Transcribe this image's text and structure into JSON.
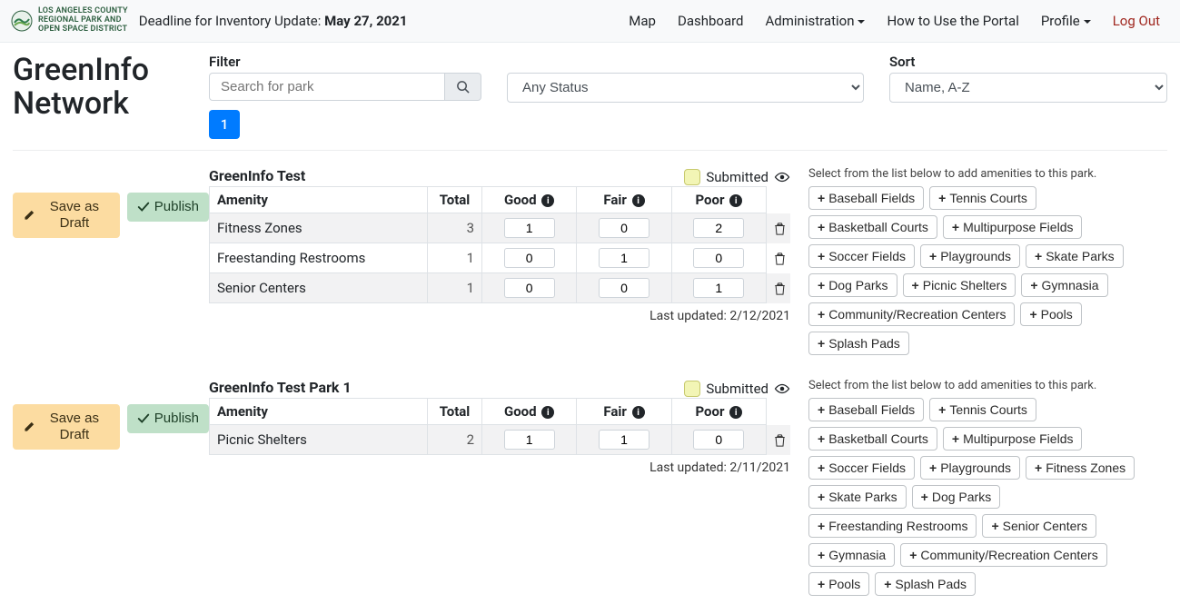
{
  "brand": {
    "line1": "LOS ANGELES COUNTY",
    "line2": "REGIONAL PARK AND",
    "line3": "OPEN SPACE DISTRICT"
  },
  "deadline": {
    "prefix": "Deadline for Inventory Update: ",
    "date": "May 27, 2021"
  },
  "nav": {
    "map": "Map",
    "dashboard": "Dashboard",
    "admin": "Administration",
    "howto": "How to Use the Portal",
    "profile": "Profile",
    "logout": "Log Out"
  },
  "org_name": "GreenInfo Network",
  "filter": {
    "label": "Filter",
    "search_placeholder": "Search for park",
    "status_value": "Any Status"
  },
  "sort": {
    "label": "Sort",
    "value": "Name, A-Z"
  },
  "pagination": {
    "current": "1"
  },
  "actions": {
    "save_draft": "Save as Draft",
    "publish": "Publish"
  },
  "table_headers": {
    "amenity": "Amenity",
    "total": "Total",
    "good": "Good",
    "fair": "Fair",
    "poor": "Poor"
  },
  "submitted_label": "Submitted",
  "amenity_help": "Select from the list below to add amenities to this park.",
  "last_updated_prefix": "Last updated: ",
  "parks": [
    {
      "name": "GreenInfo Test",
      "last_updated": "2/12/2021",
      "rows": [
        {
          "name": "Fitness Zones",
          "total": "3",
          "good": "1",
          "fair": "0",
          "poor": "2"
        },
        {
          "name": "Freestanding Restrooms",
          "total": "1",
          "good": "0",
          "fair": "1",
          "poor": "0"
        },
        {
          "name": "Senior Centers",
          "total": "1",
          "good": "0",
          "fair": "0",
          "poor": "1"
        }
      ],
      "available": [
        "Baseball Fields",
        "Tennis Courts",
        "Basketball Courts",
        "Multipurpose Fields",
        "Soccer Fields",
        "Playgrounds",
        "Skate Parks",
        "Dog Parks",
        "Picnic Shelters",
        "Gymnasia",
        "Community/Recreation Centers",
        "Pools",
        "Splash Pads"
      ]
    },
    {
      "name": "GreenInfo Test Park 1",
      "last_updated": "2/11/2021",
      "rows": [
        {
          "name": "Picnic Shelters",
          "total": "2",
          "good": "1",
          "fair": "1",
          "poor": "0"
        }
      ],
      "available": [
        "Baseball Fields",
        "Tennis Courts",
        "Basketball Courts",
        "Multipurpose Fields",
        "Soccer Fields",
        "Playgrounds",
        "Fitness Zones",
        "Skate Parks",
        "Dog Parks",
        "Freestanding Restrooms",
        "Senior Centers",
        "Gymnasia",
        "Community/Recreation Centers",
        "Pools",
        "Splash Pads"
      ]
    }
  ]
}
